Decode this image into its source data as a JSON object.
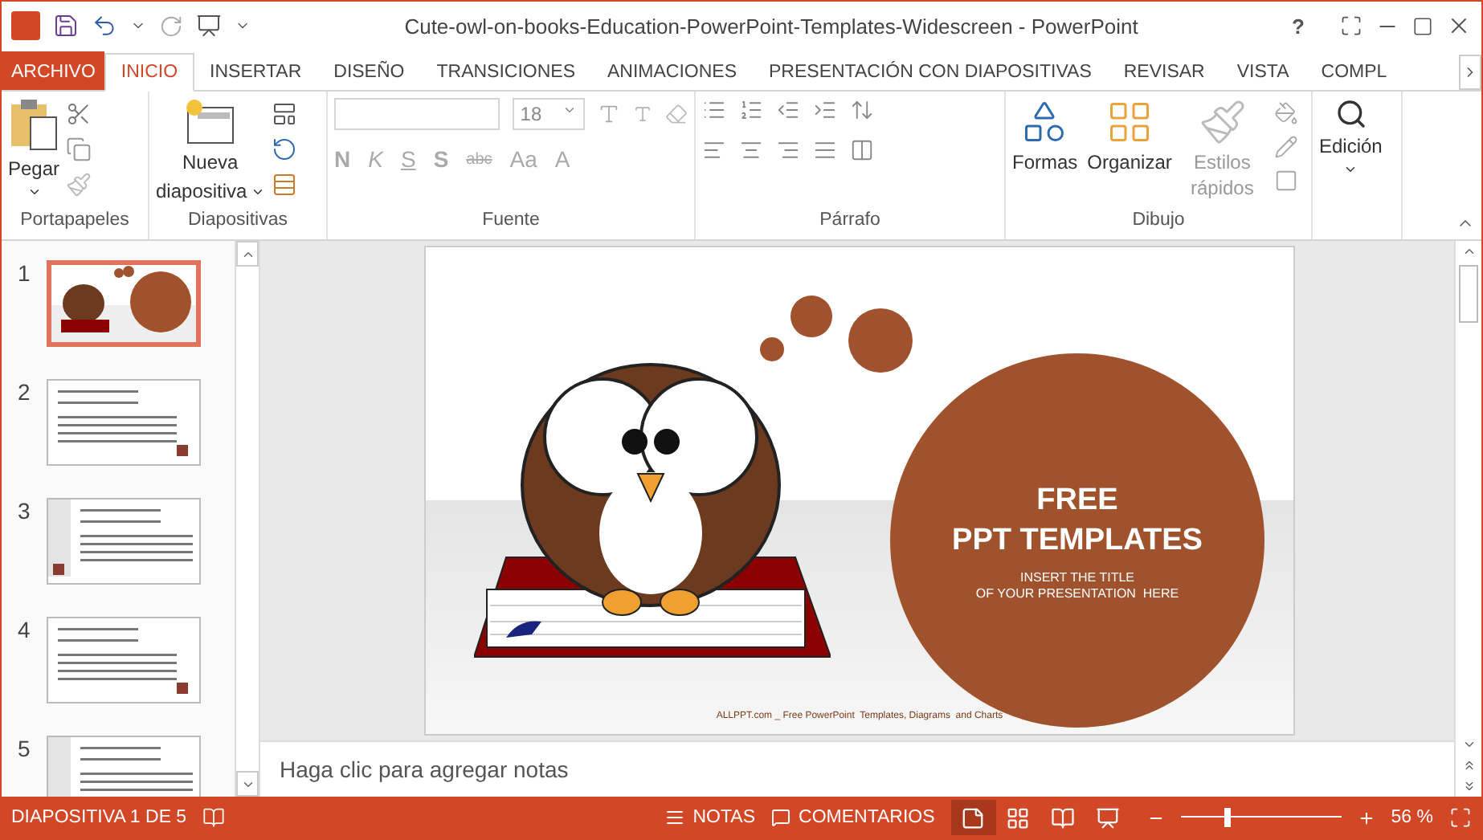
{
  "window": {
    "title": "Cute-owl-on-books-Education-PowerPoint-Templates-Widescreen - PowerPoint",
    "help": "?"
  },
  "tabs": [
    {
      "label": "ARCHIVO",
      "kind": "file",
      "selected": false
    },
    {
      "label": "INICIO",
      "kind": "tab",
      "selected": true
    },
    {
      "label": "INSERTAR",
      "kind": "tab",
      "selected": false
    },
    {
      "label": "DISEÑO",
      "kind": "tab",
      "selected": false
    },
    {
      "label": "TRANSICIONES",
      "kind": "tab",
      "selected": false
    },
    {
      "label": "ANIMACIONES",
      "kind": "tab",
      "selected": false
    },
    {
      "label": "PRESENTACIÓN CON DIAPOSITIVAS",
      "kind": "tab",
      "selected": false
    },
    {
      "label": "REVISAR",
      "kind": "tab",
      "selected": false
    },
    {
      "label": "VISTA",
      "kind": "tab",
      "selected": false
    },
    {
      "label": "COMPL",
      "kind": "tab",
      "selected": false
    }
  ],
  "ribbon": {
    "clipboard": {
      "label": "Portapapeles",
      "paste": "Pegar"
    },
    "slides": {
      "label": "Diapositivas",
      "new_slide_line1": "Nueva",
      "new_slide_line2": "diapositiva"
    },
    "font": {
      "label": "Fuente",
      "font_size": "18",
      "format_buttons": [
        {
          "text": "N",
          "kind": "bold"
        },
        {
          "text": "K",
          "kind": "italic"
        },
        {
          "text": "S",
          "kind": "underline"
        },
        {
          "text": "S",
          "kind": "shadow"
        },
        {
          "text": "abc",
          "kind": "strike"
        },
        {
          "text": "Aa",
          "kind": "case"
        },
        {
          "text": "A",
          "kind": "color"
        }
      ]
    },
    "paragraph": {
      "label": "Párrafo"
    },
    "drawing": {
      "label": "Dibujo",
      "buttons": [
        {
          "label": "Formas",
          "kind": "shapes",
          "disabled": false
        },
        {
          "label": "Organizar",
          "kind": "arrange",
          "disabled": false
        },
        {
          "label": "Estilos rápidos",
          "kind": "styles",
          "disabled": true
        }
      ]
    },
    "editing": {
      "label": "Edición"
    }
  },
  "thumbnails": [
    {
      "number": "1",
      "kind": "title",
      "selected": true
    },
    {
      "number": "2",
      "kind": "content",
      "selected": false
    },
    {
      "number": "3",
      "kind": "side",
      "selected": false
    },
    {
      "number": "4",
      "kind": "content",
      "selected": false
    },
    {
      "number": "5",
      "kind": "side",
      "selected": false
    }
  ],
  "slide": {
    "title_line1": "FREE",
    "title_line2": "PPT TEMPLATES",
    "subtitle_line1": "INSERT THE TITLE",
    "subtitle_line2": "OF YOUR PRESENTATION  HERE",
    "footer": "ALLPPT.com _ Free PowerPoint  Templates, Diagrams  and Charts"
  },
  "notes": {
    "placeholder": "Haga clic para agregar notas"
  },
  "status_bar": {
    "slide_info": "DIAPOSITIVA 1 DE 5",
    "notes": "NOTAS",
    "comments": "COMENTARIOS",
    "views": [
      {
        "kind": "normal",
        "selected": true
      },
      {
        "kind": "sorter",
        "selected": false
      },
      {
        "kind": "reading",
        "selected": false
      },
      {
        "kind": "show",
        "selected": false
      }
    ],
    "zoom": {
      "level": 0.27,
      "reading": "56 %"
    }
  }
}
